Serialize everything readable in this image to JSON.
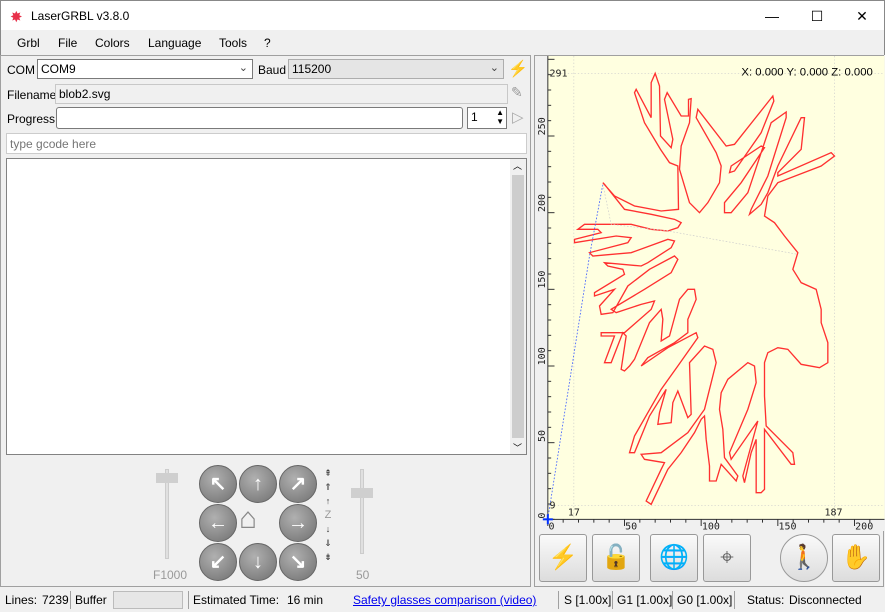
{
  "window": {
    "title": "LaserGRBL v3.8.0",
    "minimize": "—",
    "maximize": "☐",
    "close": "✕"
  },
  "menu": [
    "Grbl",
    "File",
    "Colors",
    "Language",
    "Tools",
    "?"
  ],
  "connection": {
    "com_label": "COM",
    "com_value": "COM9",
    "baud_label": "Baud",
    "baud_value": "115200"
  },
  "file": {
    "filename_label": "Filename",
    "filename_value": "blob2.svg",
    "progress_label": "Progress",
    "progress_value": 0,
    "copies": "1"
  },
  "gcode": {
    "placeholder": "type gcode here"
  },
  "jog": {
    "feed_label": "F1000",
    "step_label": "50",
    "z_label": "Z",
    "feed_slider_fraction": 1.0,
    "step_slider_fraction": 0.75
  },
  "preview": {
    "coords": "X: 0.000 Y: 0.000 Z: 0.000",
    "bbox_labels": {
      "ymax": "291",
      "ymin": "9",
      "xmin": "17",
      "xmax": "187"
    },
    "x_ticks": [
      "0",
      "50",
      "100",
      "150",
      "200"
    ],
    "y_ticks": [
      "0",
      "50",
      "100",
      "150",
      "200",
      "250"
    ],
    "path_color": "#ff0000",
    "background": "#ffffe0"
  },
  "status": {
    "lines_label": "Lines:",
    "lines_value": "7239",
    "buffer_label": "Buffer",
    "est_label": "Estimated Time:",
    "est_value": "16 min",
    "link": "Safety glasses comparison (video)",
    "s": "S [1.00x]",
    "g1": "G1 [1.00x]",
    "g0": "G0 [1.00x]",
    "status_label": "Status:",
    "status_value": "Disconnected"
  }
}
